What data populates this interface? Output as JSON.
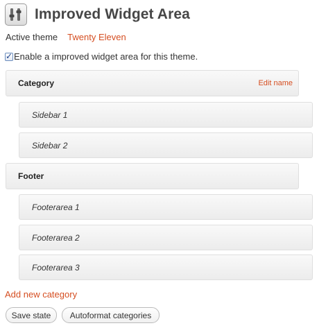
{
  "header": {
    "title": "Improved Widget Area",
    "icon": "plugin-settings-icon"
  },
  "active_theme": {
    "label": "Active theme",
    "value": "Twenty Eleven"
  },
  "enable_option": {
    "label": "Enable a improved widget area for this theme.",
    "checked": true
  },
  "categories": [
    {
      "label": "Category",
      "edit_label": "Edit name",
      "areas": [
        "Sidebar 1",
        "Sidebar 2"
      ]
    },
    {
      "label": "Footer",
      "areas": [
        "Footerarea 1",
        "Footerarea 2",
        "Footerarea 3"
      ]
    }
  ],
  "add_category_label": "Add new category",
  "buttons": {
    "save": "Save state",
    "autoformat": "Autoformat categories"
  },
  "colors": {
    "link": "#d54e21",
    "title": "#464646"
  }
}
